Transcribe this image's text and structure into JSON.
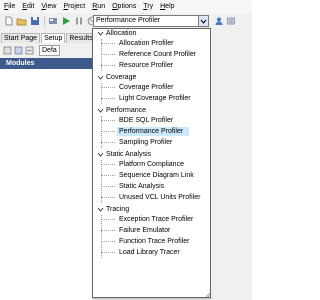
{
  "menu": [
    {
      "label": "File",
      "underline": "F",
      "rest": "ile"
    },
    {
      "label": "Edit",
      "underline": "E",
      "rest": "dit"
    },
    {
      "label": "View",
      "underline": "V",
      "rest": "iew"
    },
    {
      "label": "Project",
      "underline": "P",
      "rest": "roject"
    },
    {
      "label": "Run",
      "underline": "R",
      "rest": "un"
    },
    {
      "label": "Options",
      "underline": "O",
      "rest": "ptions"
    },
    {
      "label": "Try",
      "underline": "T",
      "rest": "ry"
    },
    {
      "label": "Help",
      "underline": "H",
      "rest": "elp"
    }
  ],
  "toolbar": {
    "profiler_combo_value": "Performance Profiler"
  },
  "tabs": {
    "start_page": "Start Page",
    "setup": "Setup",
    "results": "Results",
    "active": "Setup"
  },
  "subtoolbar": {
    "default_label": "Defa"
  },
  "modules_header": "Modules",
  "dropdown": {
    "groups": [
      {
        "label": "Allocation",
        "items": [
          "Allocation Profiler",
          "Reference Count Profiler",
          "Resource Profiler"
        ]
      },
      {
        "label": "Coverage",
        "items": [
          "Coverage Profiler",
          "Light Coverage Profiler"
        ]
      },
      {
        "label": "Performance",
        "items": [
          "BDE SQL Profiler",
          "Performance Profiler",
          "Sampling Profiler"
        ]
      },
      {
        "label": "Static Analysis",
        "items": [
          "Platform Compliance",
          "Sequence Diagram Link",
          "Static Analysis",
          "Unused VCL Units Profiler"
        ]
      },
      {
        "label": "Tracing",
        "items": [
          "Exception Trace Profiler",
          "Failure Emulator",
          "Function Trace Profiler",
          "Load Library Tracer"
        ]
      }
    ],
    "selected_item": "Performance Profiler"
  },
  "colors": {
    "selection": "#cce8ff",
    "modules_header": "#3c5a8c",
    "dropdown_border": "#646464"
  }
}
